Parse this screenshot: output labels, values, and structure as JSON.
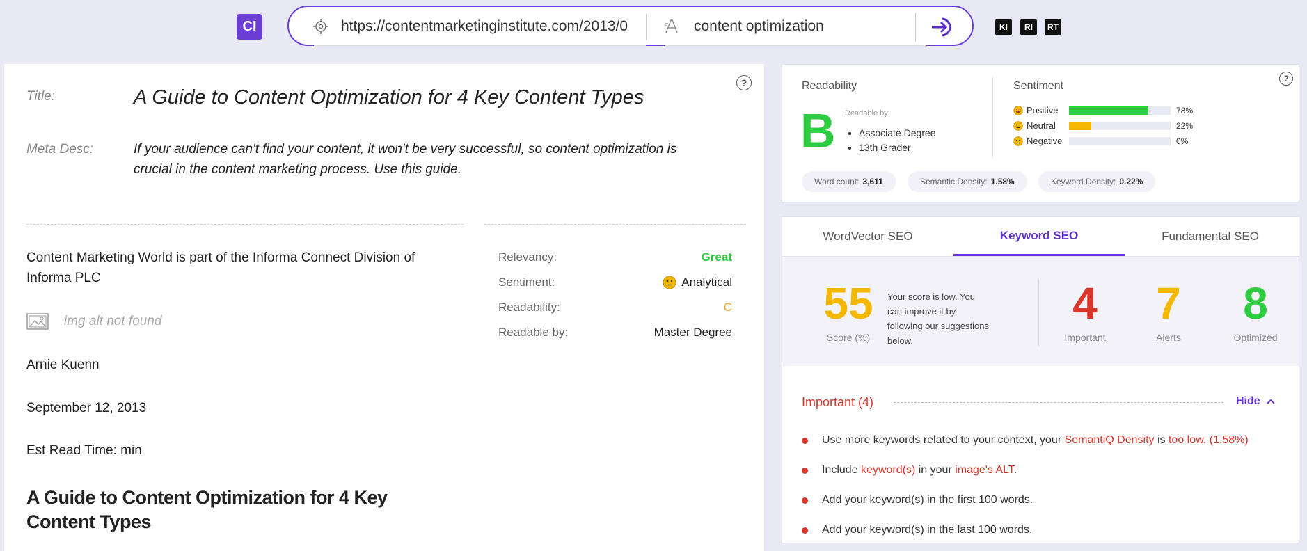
{
  "header": {
    "logo": "CI",
    "url_value": "https://contentmarketinginstitute.com/2013/0",
    "keyword_value": "content optimization",
    "badges": [
      "KI",
      "RI",
      "RT"
    ]
  },
  "content": {
    "title_label": "Title:",
    "title_value": "A Guide to Content Optimization for 4 Key Content Types",
    "meta_label": "Meta Desc:",
    "meta_value": "If your audience can't find your content, it won't be very successful, so content optimization is crucial in the content marketing process. Use this guide.",
    "paragraph": "Content Marketing World is part of the Informa Connect Division of Informa PLC",
    "img_alt": "img alt not found",
    "author": "Arnie Kuenn",
    "date": "September 12, 2013",
    "read_time": "Est Read Time: min",
    "heading": "A Guide to Content Optimization for 4 Key Content Types"
  },
  "page_stats": [
    {
      "label": "Relevancy:",
      "value": "Great",
      "color": "#2ecc40"
    },
    {
      "label": "Sentiment:",
      "value": "Analytical",
      "color": "#222222"
    },
    {
      "label": "Readability:",
      "value": "C",
      "color": "#f5a623"
    },
    {
      "label": "Readable by:",
      "value": "Master Degree",
      "color": "#222222"
    }
  ],
  "readability": {
    "label": "Readability",
    "grade": "B",
    "readable_by_label": "Readable by:",
    "readable_by": [
      "Associate Degree",
      "13th Grader"
    ]
  },
  "sentiment": {
    "label": "Sentiment",
    "rows": [
      {
        "name": "Positive",
        "pct": 78,
        "pct_label": "78%",
        "color": "#2ecc40"
      },
      {
        "name": "Neutral",
        "pct": 22,
        "pct_label": "22%",
        "color": "#f5b800"
      },
      {
        "name": "Negative",
        "pct": 0,
        "pct_label": "0%",
        "color": "#d9352b"
      }
    ]
  },
  "metrics": [
    {
      "label": "Word count:",
      "value": "3,611"
    },
    {
      "label": "Semantic Density:",
      "value": "1.58%"
    },
    {
      "label": "Keyword Density:",
      "value": "0.22%"
    }
  ],
  "tabs": [
    "WordVector SEO",
    "Keyword SEO",
    "Fundamental SEO"
  ],
  "score": {
    "value": "55",
    "label": "Score (%)",
    "message": "Your score is low. You can improve it by following our suggestions below.",
    "important": "4",
    "important_label": "Important",
    "alerts": "7",
    "alerts_label": "Alerts",
    "optimized": "8",
    "optimized_label": "Optimized"
  },
  "important_section": {
    "title": "Important (4)",
    "hide_label": "Hide",
    "s1_a": "Use more keywords related to your context, your ",
    "s1_b": "SemantiQ Density",
    "s1_c": " is ",
    "s1_d": "too low. (1.58%)",
    "s2_a": "Include ",
    "s2_b": "keyword(s)",
    "s2_c": " in your ",
    "s2_d": "image's ALT",
    "s2_e": ".",
    "s3": "Add your keyword(s) in the first 100 words.",
    "s4": "Add your keyword(s) in the last 100 words."
  }
}
